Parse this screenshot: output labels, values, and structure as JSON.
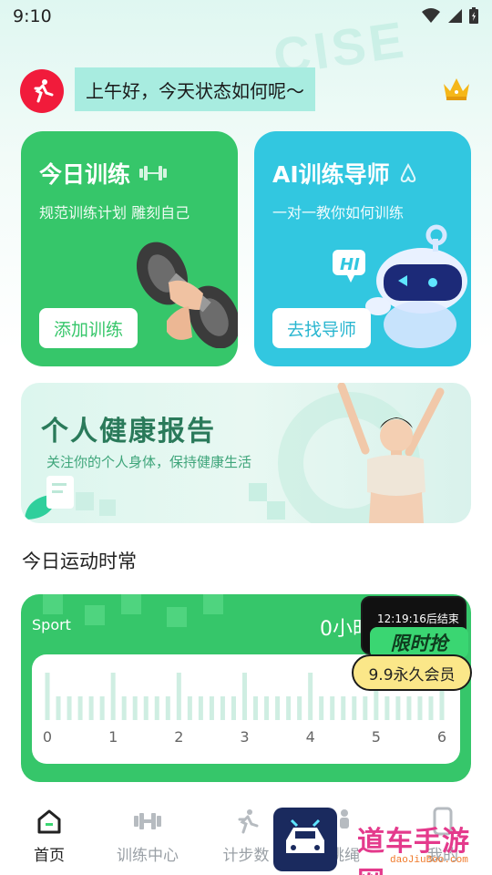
{
  "status_bar": {
    "time": "9:10"
  },
  "background_word": "CISE",
  "header": {
    "greeting": "上午好，今天状态如何呢～"
  },
  "cards": [
    {
      "title": "今日训练",
      "subtitle": "规范训练计划 雕刻自己",
      "button": "添加训练"
    },
    {
      "title": "AI训练导师",
      "subtitle": "一对一教你如何训练",
      "button": "去找导师",
      "bubble": "HI"
    }
  ],
  "banner": {
    "title": "个人健康报告",
    "subtitle": "关注你的个人身体，保持健康生活"
  },
  "sport_section": {
    "title": "今日运动时常",
    "label": "Sport",
    "value": "0小时"
  },
  "chart_data": {
    "type": "bar",
    "x_ticks": [
      "0",
      "1",
      "2",
      "3",
      "4",
      "5",
      "6"
    ],
    "xlim": [
      0,
      6
    ],
    "bars_per_unit": 6,
    "values": [
      0
    ],
    "major_every": 6,
    "grid": false
  },
  "promo": {
    "timer": "12:19:16后结束",
    "headline": "限时抢",
    "offer": "9.9永久会员"
  },
  "bottom_nav": [
    {
      "label": "首页",
      "icon": "home-icon",
      "active": true
    },
    {
      "label": "训练中心",
      "icon": "dumbbell-icon",
      "active": false
    },
    {
      "label": "计步数",
      "icon": "runner-icon",
      "active": false
    },
    {
      "label": "跳绳",
      "icon": "person-icon",
      "active": false
    },
    {
      "label": "我的",
      "icon": "phone-icon",
      "active": false
    }
  ],
  "watermark": {
    "text": "道车手游网",
    "url": "daoJiuBoo.com"
  },
  "colors": {
    "green": "#36c66a",
    "cyan": "#32c7e0",
    "avatar_red": "#f11b3b",
    "greeting_bg": "#a8ece0",
    "promo_pill": "#fbe789"
  }
}
